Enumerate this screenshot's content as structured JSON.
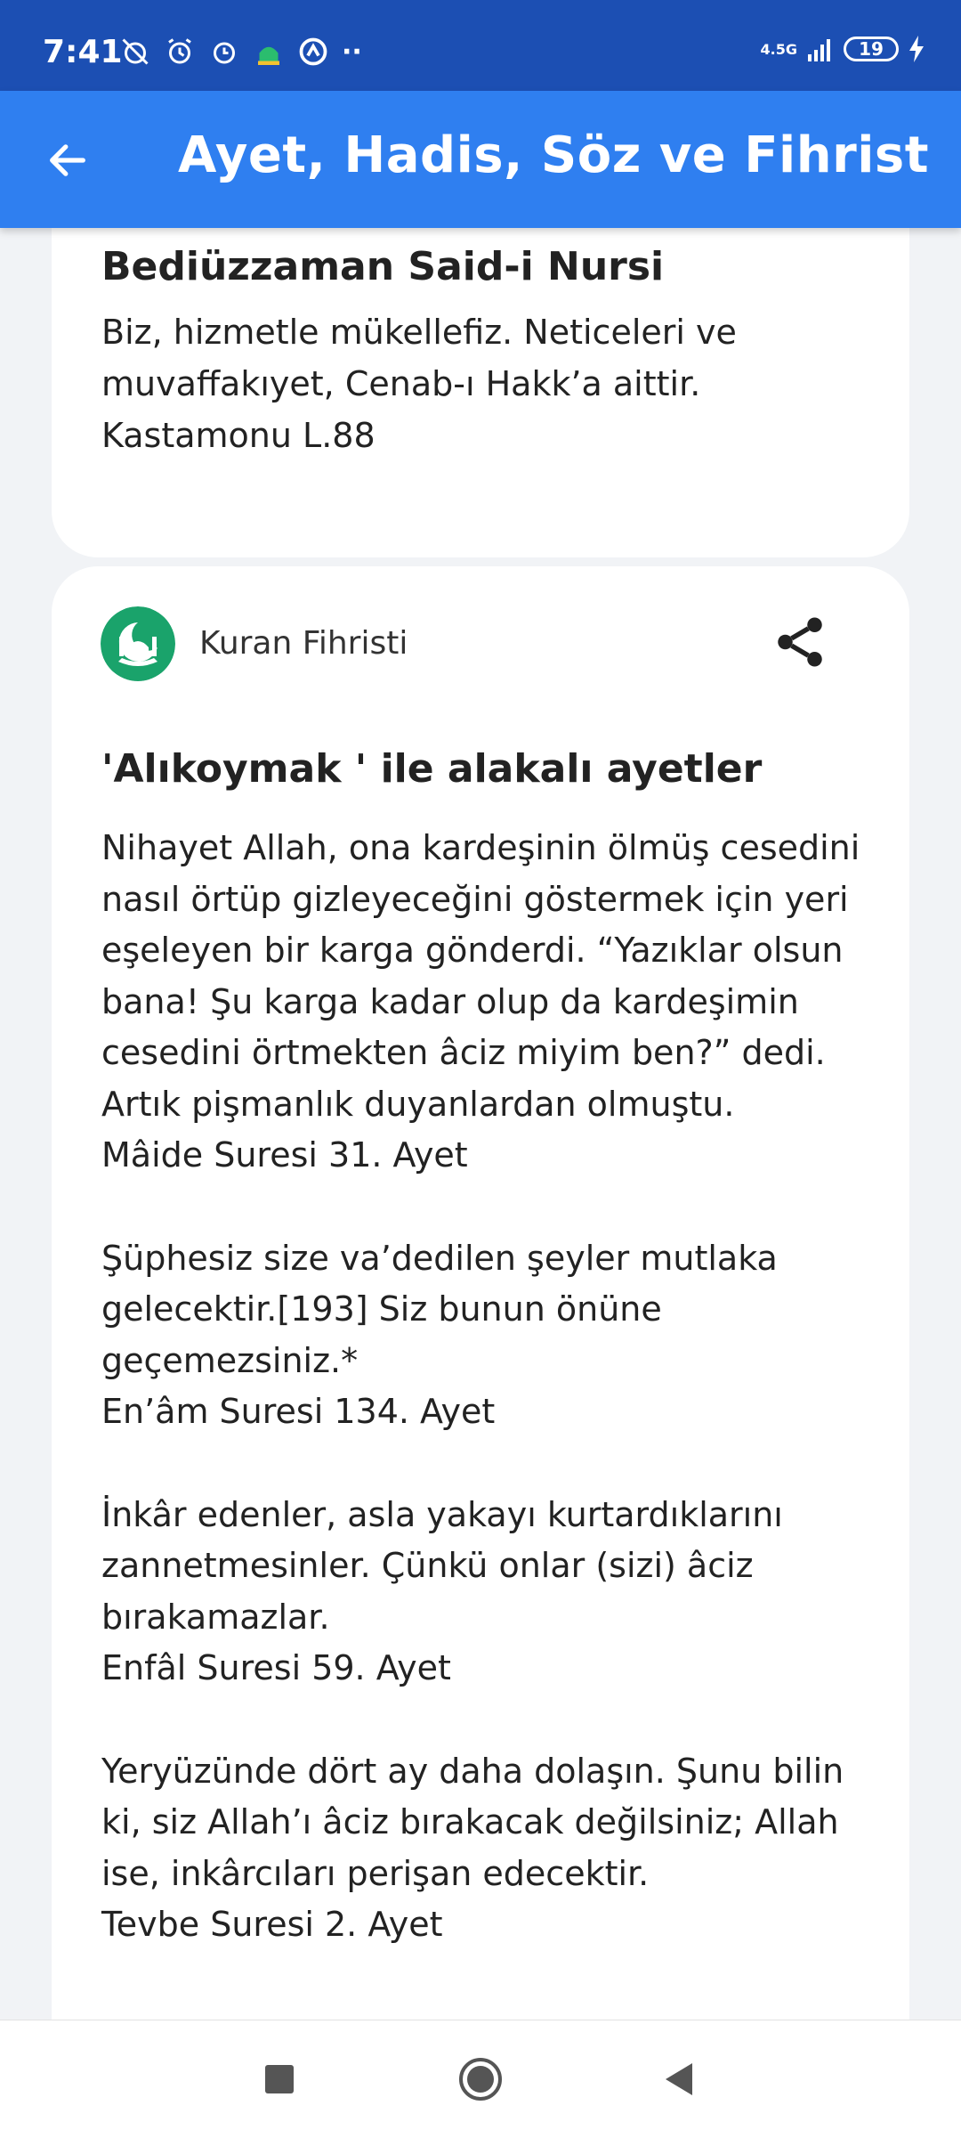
{
  "status_bar": {
    "time": "7:41",
    "network": "4.5G",
    "battery": "19"
  },
  "app_bar": {
    "title": "Ayet, Hadis, Söz ve Fihrist"
  },
  "cards": [
    {
      "author": "Bediüzzaman Said-i Nursi",
      "quote": "Biz, hizmetle mükellefiz. Neticeleri ve muvaffakıyet, Cenab-ı Hakk’a aittir.",
      "reference": "Kastamonu L.88"
    },
    {
      "source": "Kuran Fihristi",
      "heading": "'Alıkoymak ' ile alakalı ayetler",
      "verses": [
        {
          "text": "Nihayet Allah, ona kardeşinin ölmüş cesedini nasıl örtüp gizleyeceğini göstermek için yeri eşeleyen bir karga gönderdi. “Yazıklar olsun bana! Şu karga kadar olup da kardeşimin cesedini örtmekten âciz miyim ben?” dedi. Artık pişmanlık duyanlardan olmuştu.",
          "reference": "Mâide Suresi 31. Ayet"
        },
        {
          "text": "Şüphesiz size va’dedilen şeyler mutlaka gelecektir.[193] Siz bunun önüne geçemezsiniz.*",
          "reference": "En’âm Suresi 134. Ayet"
        },
        {
          "text": "İnkâr edenler, asla yakayı kurtardıklarını zannetmesinler. Çünkü onlar (sizi) âciz bırakamazlar.",
          "reference": "Enfâl Suresi 59. Ayet"
        },
        {
          "text": "Yeryüzünde dört ay daha dolaşın. Şunu bilin ki, siz Allah’ı âciz bırakacak değilsiniz; Allah ise, inkârcıları perişan edecektir.",
          "reference": "Tevbe Suresi 2. Ayet"
        }
      ]
    }
  ],
  "colors": {
    "status_bar": "#1c4fb3",
    "app_bar": "#2f7ff0",
    "logo_green": "#1aa36b",
    "page_bg": "#f1f3f6"
  }
}
